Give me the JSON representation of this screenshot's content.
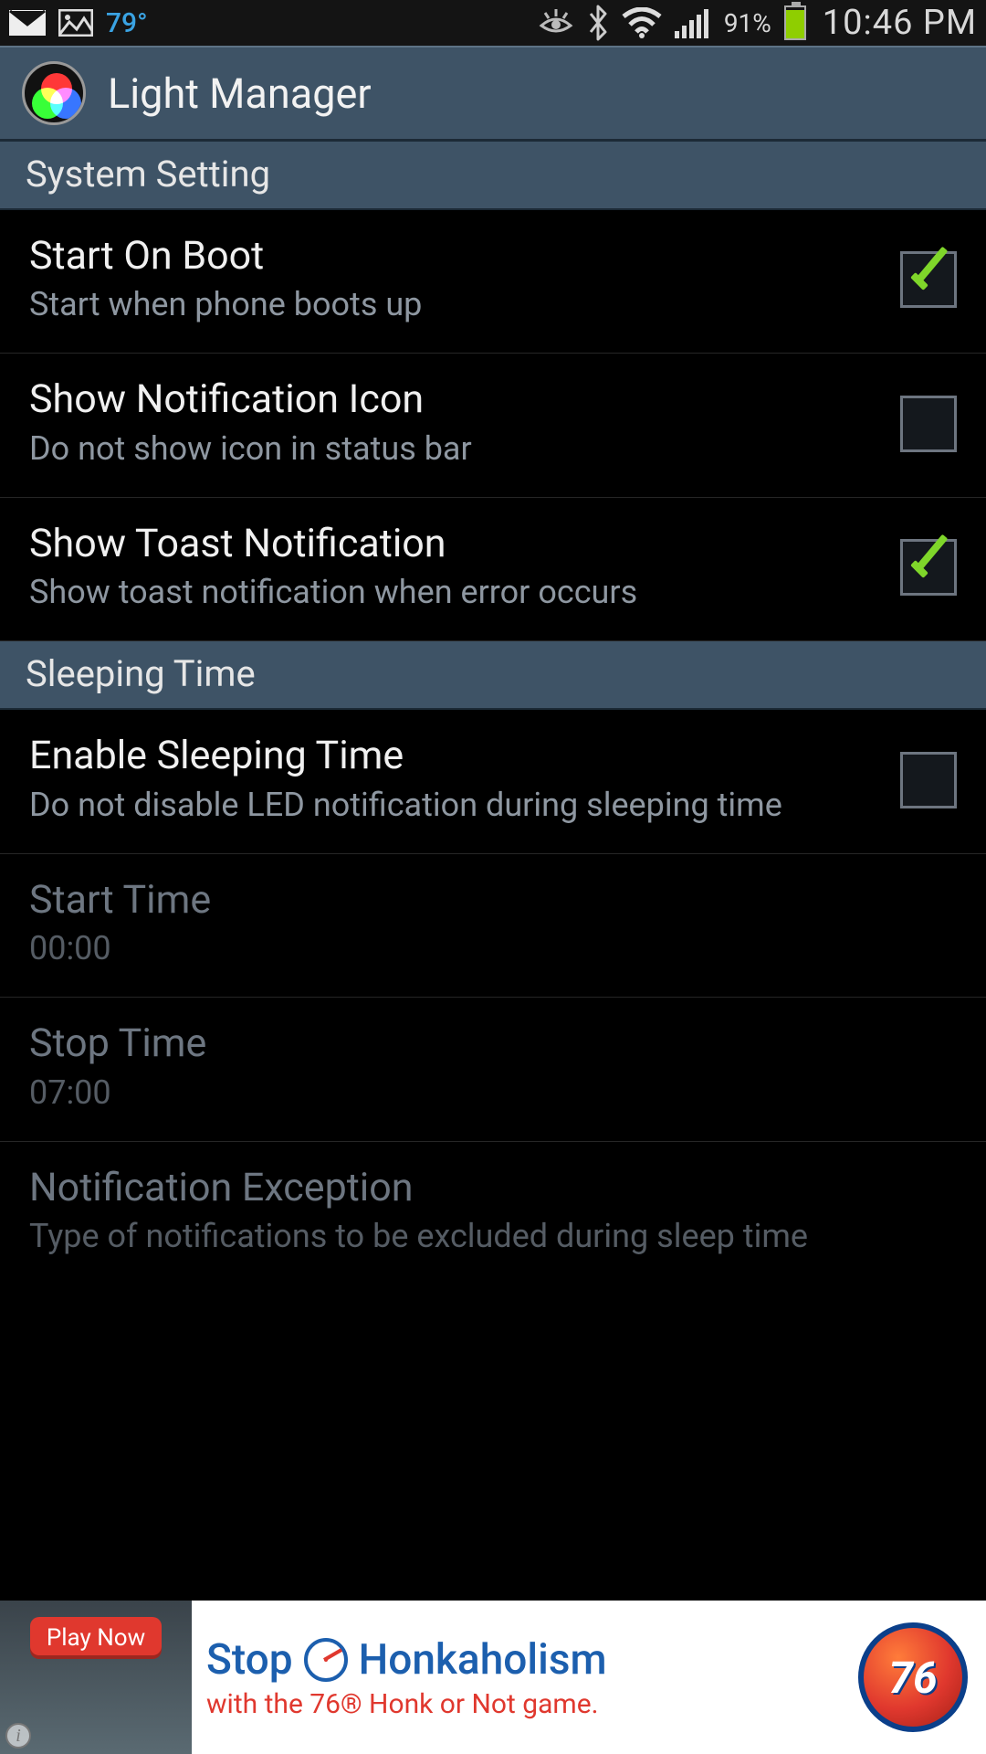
{
  "status": {
    "temperature": "79°",
    "battery_percent": "91%",
    "battery_level": 91,
    "clock": "10:46 PM"
  },
  "app": {
    "title": "Light Manager"
  },
  "sections": {
    "system": "System Setting",
    "sleeping": "Sleeping Time"
  },
  "prefs": {
    "start_on_boot": {
      "title": "Start On Boot",
      "sub": "Start when phone boots up",
      "checked": true
    },
    "show_notif_icon": {
      "title": "Show Notification Icon",
      "sub": "Do not show icon in status bar",
      "checked": false
    },
    "show_toast": {
      "title": "Show Toast Notification",
      "sub": "Show toast notification when error occurs",
      "checked": true
    },
    "enable_sleep": {
      "title": "Enable Sleeping Time",
      "sub": "Do not disable LED notification during sleeping time",
      "checked": false
    },
    "start_time": {
      "title": "Start Time",
      "sub": "00:00"
    },
    "stop_time": {
      "title": "Stop Time",
      "sub": "07:00"
    },
    "notif_exception": {
      "title": "Notification Exception",
      "sub": "Type of notifications to be excluded during sleep time"
    }
  },
  "ad": {
    "play": "Play Now",
    "line1a": "Stop",
    "line1b": "Honkaholism",
    "line2": "with the 76® Honk or Not game.",
    "logo": "76"
  }
}
